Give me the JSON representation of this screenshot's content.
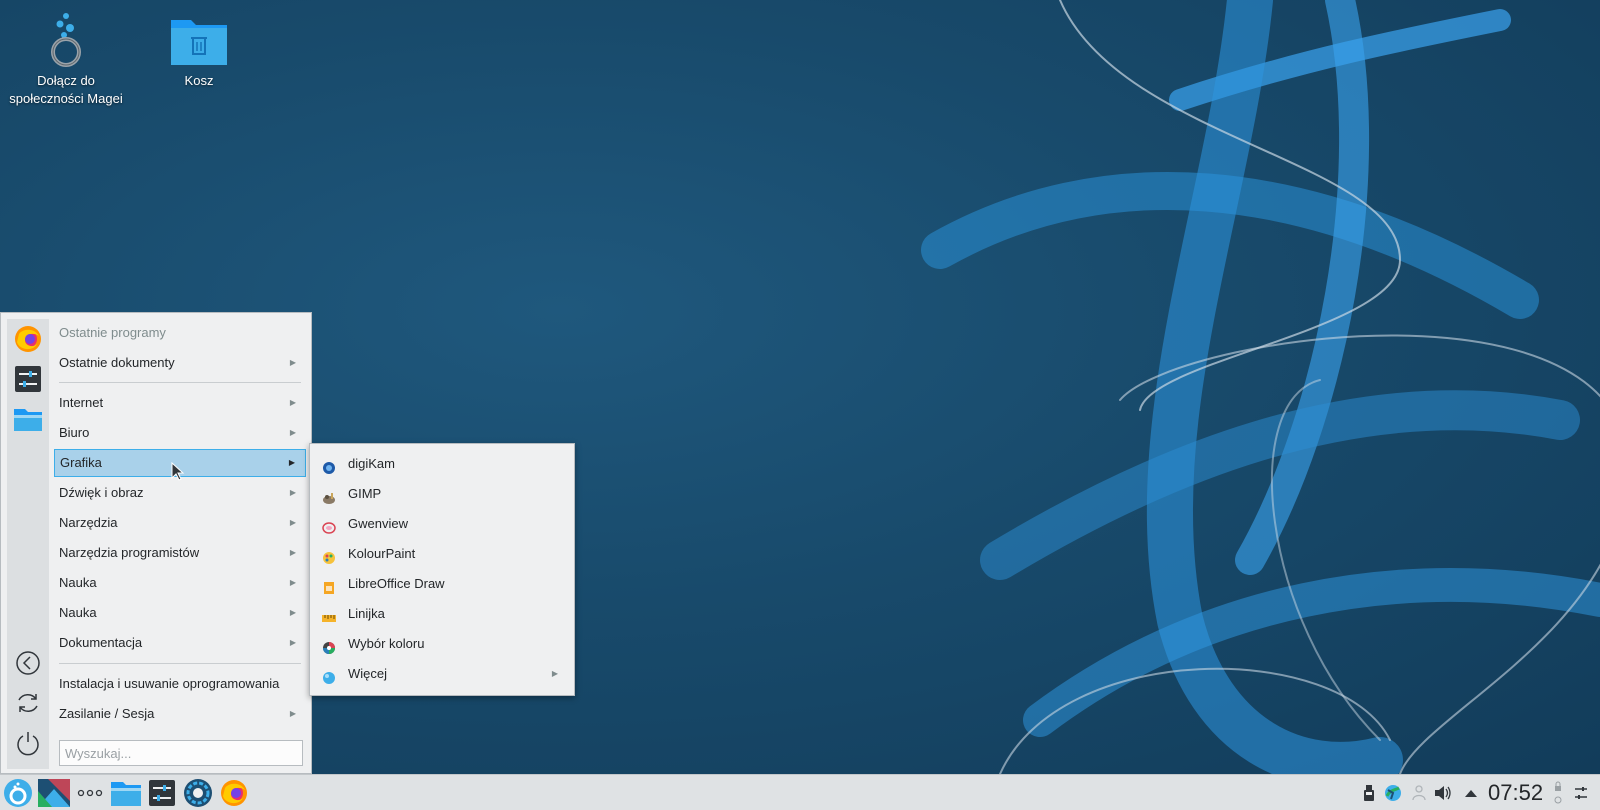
{
  "desktop": {
    "icons": [
      {
        "label": "Dołącz do społeczności Magei",
        "icon": "mageia-community-icon"
      },
      {
        "label": "Kosz",
        "icon": "trash-folder-icon"
      }
    ]
  },
  "menu": {
    "favorites": [
      "firefox-icon",
      "settings-icon",
      "file-manager-icon"
    ],
    "actions": [
      "back-icon",
      "restart-icon",
      "power-icon"
    ],
    "items": [
      {
        "label": "Ostatnie programy"
      },
      {
        "label": "Ostatnie dokumenty"
      },
      {
        "label": "Internet"
      },
      {
        "label": "Biuro"
      },
      {
        "label": "Grafika"
      },
      {
        "label": "Dźwięk i obraz"
      },
      {
        "label": "Narzędzia"
      },
      {
        "label": "Narzędzia programistów"
      },
      {
        "label": "Nauka"
      },
      {
        "label": "Nauka"
      },
      {
        "label": "Dokumentacja"
      },
      {
        "label": "Instalacja i usuwanie oprogramowania"
      },
      {
        "label": "Zasilanie / Sesja"
      }
    ],
    "search_placeholder": "Wyszukaj..."
  },
  "submenu": {
    "items": [
      {
        "label": "digiKam",
        "icon": "digikam-icon"
      },
      {
        "label": "GIMP",
        "icon": "gimp-icon"
      },
      {
        "label": "Gwenview",
        "icon": "gwenview-icon"
      },
      {
        "label": "KolourPaint",
        "icon": "kolourpaint-icon"
      },
      {
        "label": "LibreOffice Draw",
        "icon": "libreoffice-draw-icon"
      },
      {
        "label": "Linijka",
        "icon": "ruler-icon"
      },
      {
        "label": "Wybór koloru",
        "icon": "color-picker-icon"
      },
      {
        "label": "Więcej",
        "icon": "more-icon"
      }
    ]
  },
  "taskbar": {
    "clock": "07:52"
  },
  "colors": {
    "accent": "#3daee9",
    "highlight": "#a9d1ea",
    "menu_bg": "#eff0f1",
    "desktop": "#184a6b"
  }
}
